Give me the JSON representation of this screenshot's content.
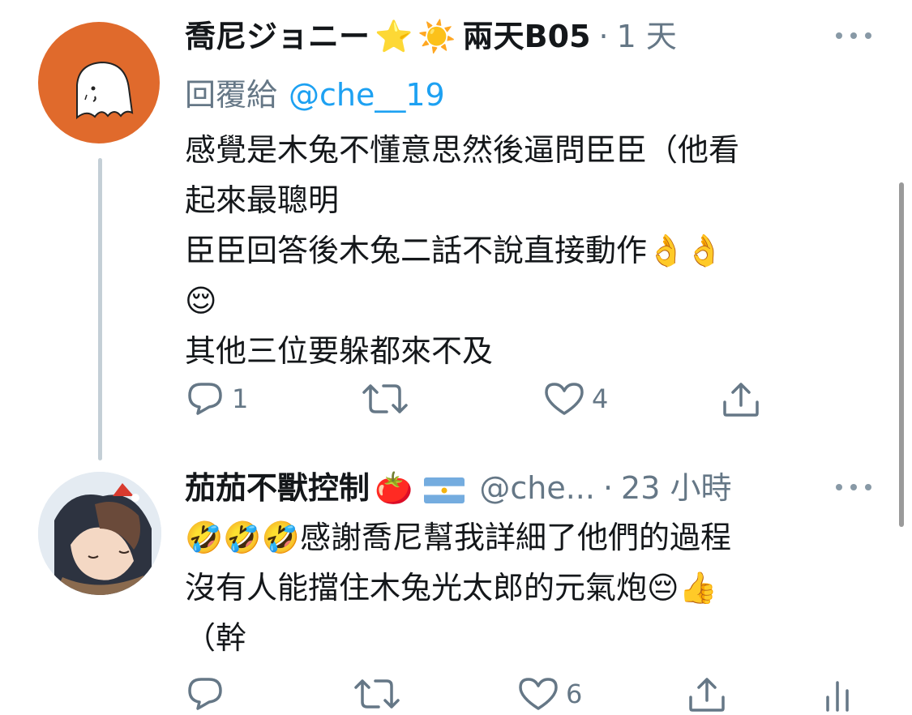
{
  "tweets": [
    {
      "display_name": "喬尼ジョニー",
      "name_emojis": [
        "⭐",
        "☀️"
      ],
      "name_suffix": "兩天B05",
      "time": "1 天",
      "reply_label": "回覆給",
      "reply_handle": "@che__19",
      "text": "感覺是木兔不懂意思然後逼問臣臣（他看\n起來最聰明\n臣臣回答後木兔二話不說直接動作👌👌\n😌\n其他三位要躲都來不及",
      "reply_count": "1",
      "retweet_count": "",
      "like_count": "4"
    },
    {
      "display_name": "茄茄不獸控制",
      "name_emojis": [
        "🍅",
        "🇦🇷"
      ],
      "handle": "@che...",
      "time": "23 小時",
      "text": "🤣🤣🤣感謝喬尼幫我詳細了他們的過程\n沒有人能擋住木兔光太郎的元氣炮😔👍\n（幹",
      "reply_count": "",
      "retweet_count": "",
      "like_count": "6"
    }
  ],
  "colors": {
    "accent": "#1da1f2",
    "muted": "#657786",
    "avatar_orange": "#e06a2c"
  },
  "icons": {
    "reply": "reply-icon",
    "retweet": "retweet-icon",
    "like": "like-icon",
    "share": "share-icon",
    "analytics": "analytics-icon",
    "more": "more-icon"
  }
}
